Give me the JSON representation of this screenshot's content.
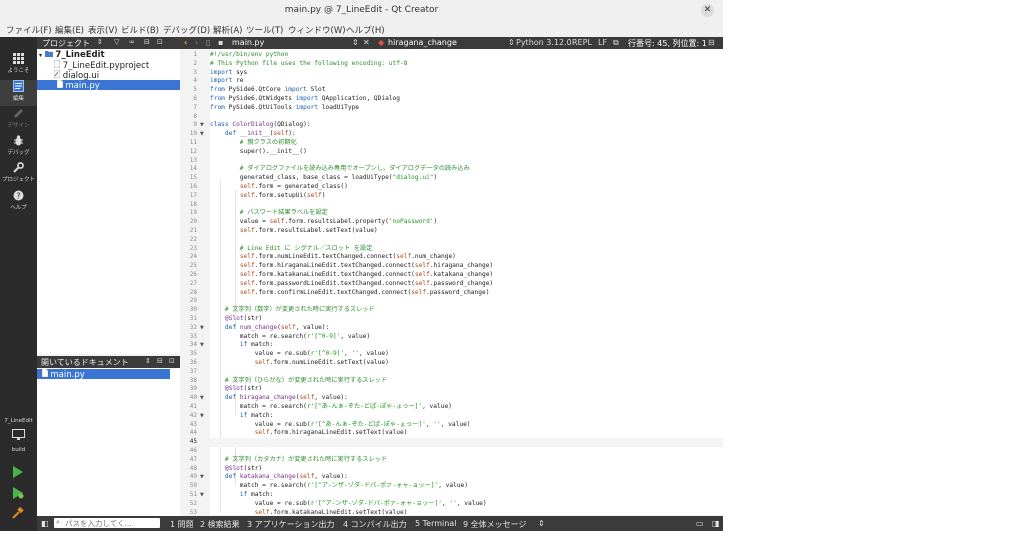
{
  "window": {
    "title": "main.py @ 7_LineEdit - Qt Creator",
    "close_glyph": "✕"
  },
  "menu": [
    "ファイル(F)",
    "編集(E)",
    "表示(V)",
    "ビルド(B)",
    "デバッグ(D)",
    "解析(A)",
    "ツール(T)",
    "ウィンドウ(W)",
    "ヘルプ(H)"
  ],
  "modes": [
    {
      "label": "ようこそ",
      "icon": "grid-icon"
    },
    {
      "label": "編集",
      "icon": "edit-icon"
    },
    {
      "label": "デザイン",
      "icon": "pen-icon"
    },
    {
      "label": "デバッグ",
      "icon": "bug-icon"
    },
    {
      "label": "プロジェクト",
      "icon": "wrench-icon"
    },
    {
      "label": "ヘルプ",
      "icon": "help-icon"
    }
  ],
  "kit": {
    "project": "7_LineEdit",
    "config": "build"
  },
  "project_panel": {
    "title": "プロジェクト",
    "tree": [
      {
        "label": "7_LineEdit",
        "icon": "folder-icon",
        "depth": 0
      },
      {
        "label": "7_LineEdit.pyproject",
        "icon": "file-icon",
        "depth": 1
      },
      {
        "label": "dialog.ui",
        "icon": "ui-file-icon",
        "depth": 1
      },
      {
        "label": "main.py",
        "icon": "python-file-icon",
        "depth": 1,
        "selected": true
      }
    ]
  },
  "open_docs": {
    "title": "開いているドキュメント",
    "items": [
      "main.py"
    ]
  },
  "editor_toolbar": {
    "file": "main.py",
    "symbol": "hiragana_change",
    "python": "Python 3.12.0",
    "repl": "REPL",
    "line_ending": "LF",
    "position": "行番号: 45, 列位置: 1"
  },
  "current_line": 45,
  "code": [
    {
      "n": 1,
      "t": "#!/usr/bin/env python"
    },
    {
      "n": 2,
      "t": "# This Python file uses the following encoding: utf-8"
    },
    {
      "n": 3,
      "t": "import sys"
    },
    {
      "n": 4,
      "t": "import re"
    },
    {
      "n": 5,
      "t": "from PySide6.QtCore import Slot"
    },
    {
      "n": 6,
      "t": "from PySide6.QtWidgets import QApplication, QDialog"
    },
    {
      "n": 7,
      "t": "from PySide6.QtUiTools import loadUiType"
    },
    {
      "n": 8,
      "t": ""
    },
    {
      "n": 9,
      "t": "class ColorDialog(QDialog):"
    },
    {
      "n": 10,
      "t": "    def __init__(self):"
    },
    {
      "n": 11,
      "t": "        # 親クラスの初期化"
    },
    {
      "n": 12,
      "t": "        super().__init__()"
    },
    {
      "n": 13,
      "t": ""
    },
    {
      "n": 14,
      "t": "        # ダイアログファイルを読み込み専用でオープンし、ダイアログデータの読み込み"
    },
    {
      "n": 15,
      "t": "        generated_class, base_class = loadUiType(\"dialog.ui\")"
    },
    {
      "n": 16,
      "t": "        self.form = generated_class()"
    },
    {
      "n": 17,
      "t": "        self.form.setupUi(self)"
    },
    {
      "n": 18,
      "t": ""
    },
    {
      "n": 19,
      "t": "        # パスワード結果ラベルを設定"
    },
    {
      "n": 20,
      "t": "        value = self.form.resultsLabel.property('noPassword')"
    },
    {
      "n": 21,
      "t": "        self.form.resultsLabel.setText(value)"
    },
    {
      "n": 22,
      "t": ""
    },
    {
      "n": 23,
      "t": "        # Line Edit に シグナル／スロット を設定"
    },
    {
      "n": 24,
      "t": "        self.form.numLineEdit.textChanged.connect(self.num_change)"
    },
    {
      "n": 25,
      "t": "        self.form.hiraganaLineEdit.textChanged.connect(self.hiragana_change)"
    },
    {
      "n": 26,
      "t": "        self.form.katakanaLineEdit.textChanged.connect(self.katakana_change)"
    },
    {
      "n": 27,
      "t": "        self.form.passwordLineEdit.textChanged.connect(self.password_change)"
    },
    {
      "n": 28,
      "t": "        self.form.confirmLineEdit.textChanged.connect(self.password_change)"
    },
    {
      "n": 29,
      "t": ""
    },
    {
      "n": 30,
      "t": "    # 文字列（数字）が変更された時に実行するスレッド"
    },
    {
      "n": 31,
      "t": "    @Slot(str)"
    },
    {
      "n": 32,
      "t": "    def num_change(self, value):"
    },
    {
      "n": 33,
      "t": "        match = re.search(r'[^0-9]', value)"
    },
    {
      "n": 34,
      "t": "        if match:"
    },
    {
      "n": 35,
      "t": "            value = re.sub(r'[^0-9]', '', value)"
    },
    {
      "n": 36,
      "t": "            self.form.numLineEdit.setText(value)"
    },
    {
      "n": 37,
      "t": ""
    },
    {
      "n": 38,
      "t": "    # 文字列（ひらがな）が変更された時に実行するスレッド"
    },
    {
      "n": 39,
      "t": "    @Slot(str)"
    },
    {
      "n": 40,
      "t": "    def hiragana_change(self, value):"
    },
    {
      "n": 41,
      "t": "        match = re.search(r'[^あ-んぁ-ぞた-どぱ-ぽゃ-ょっー]', value)"
    },
    {
      "n": 42,
      "t": "        if match:"
    },
    {
      "n": 43,
      "t": "            value = re.sub(r'[^あ-んぁ-ぞた-どぱ-ぽゃ-ょっー]', '', value)"
    },
    {
      "n": 44,
      "t": "            self.form.hiraganaLineEdit.setText(value)"
    },
    {
      "n": 45,
      "t": ""
    },
    {
      "n": 46,
      "t": ""
    },
    {
      "n": 47,
      "t": "    # 文字列（カタカナ）が変更された時に実行するスレッド"
    },
    {
      "n": 48,
      "t": "    @Slot(str)"
    },
    {
      "n": 49,
      "t": "    def katakana_change(self, value):"
    },
    {
      "n": 50,
      "t": "        match = re.search(r'[^ア-ンザ-ゾダ-ドパ-ポァ-ォャ-ョッー]', value)"
    },
    {
      "n": 51,
      "t": "        if match:"
    },
    {
      "n": 52,
      "t": "            value = re.sub(r'[^ア-ンザ-ゾダ-ドパ-ポァ-ォャ-ョッー]', '', value)"
    },
    {
      "n": 53,
      "t": "            self.form.katakanaLineEdit.setText(value)"
    }
  ],
  "foldable_lines": [
    9,
    10,
    32,
    34,
    40,
    42,
    49,
    51
  ],
  "status": {
    "search_placeholder": "パスを入力してく...",
    "panes": [
      "1 問題",
      "2 検索結果",
      "3 アプリケーション出力",
      "4 コンパイル出力",
      "5 Terminal",
      "9 全体メッセージ"
    ],
    "more": "⇕"
  },
  "colors": {
    "comment": "#2e8b2e",
    "keyword": "#1f5fb0",
    "string": "#1c9a1c",
    "classname": "#7a2d90",
    "self": "#b04a1a",
    "selection": "#3a75d6"
  }
}
